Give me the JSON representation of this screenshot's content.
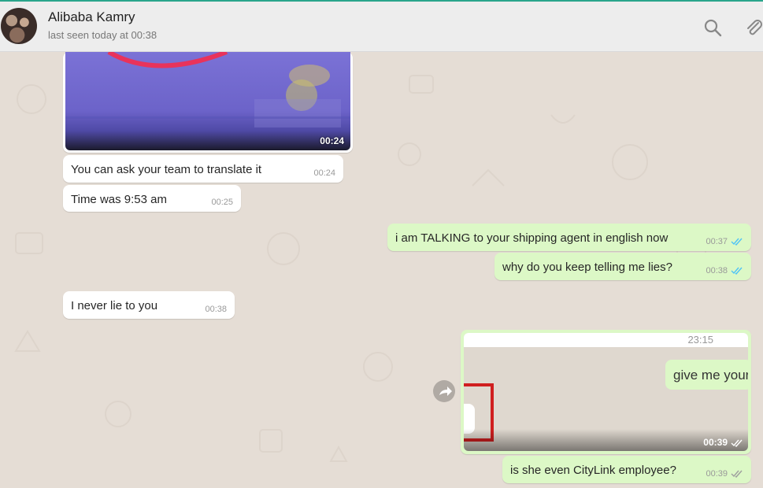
{
  "header": {
    "name": "Alibaba Kamry",
    "status": "last seen today at 00:38"
  },
  "messages": {
    "video1": {
      "duration": "00:24"
    },
    "m1": {
      "text": "You can ask your team to translate it",
      "time": "00:24"
    },
    "m2": {
      "text": "Time was 9:53 am",
      "time": "00:25"
    },
    "m3": {
      "text": "i am TALKING to your shipping agent in english now",
      "time": "00:37"
    },
    "m4": {
      "text": "why do you keep telling me lies?",
      "time": "00:38"
    },
    "m5": {
      "text": "I never lie to you",
      "time": "00:38"
    },
    "video2": {
      "inner_time": "23:15",
      "inner_text": "give me your",
      "duration": "00:39"
    },
    "m6": {
      "text": "is she even CityLink employee?",
      "time": "00:39"
    }
  },
  "icons": [
    "search-icon",
    "paperclip-icon",
    "forward-icon",
    "double-check-icon"
  ],
  "colors": {
    "incoming": "#ffffff",
    "outgoing": "#dcf8c6",
    "chat_bg": "#e5ddd5",
    "read_tick": "#4fc3f7"
  }
}
